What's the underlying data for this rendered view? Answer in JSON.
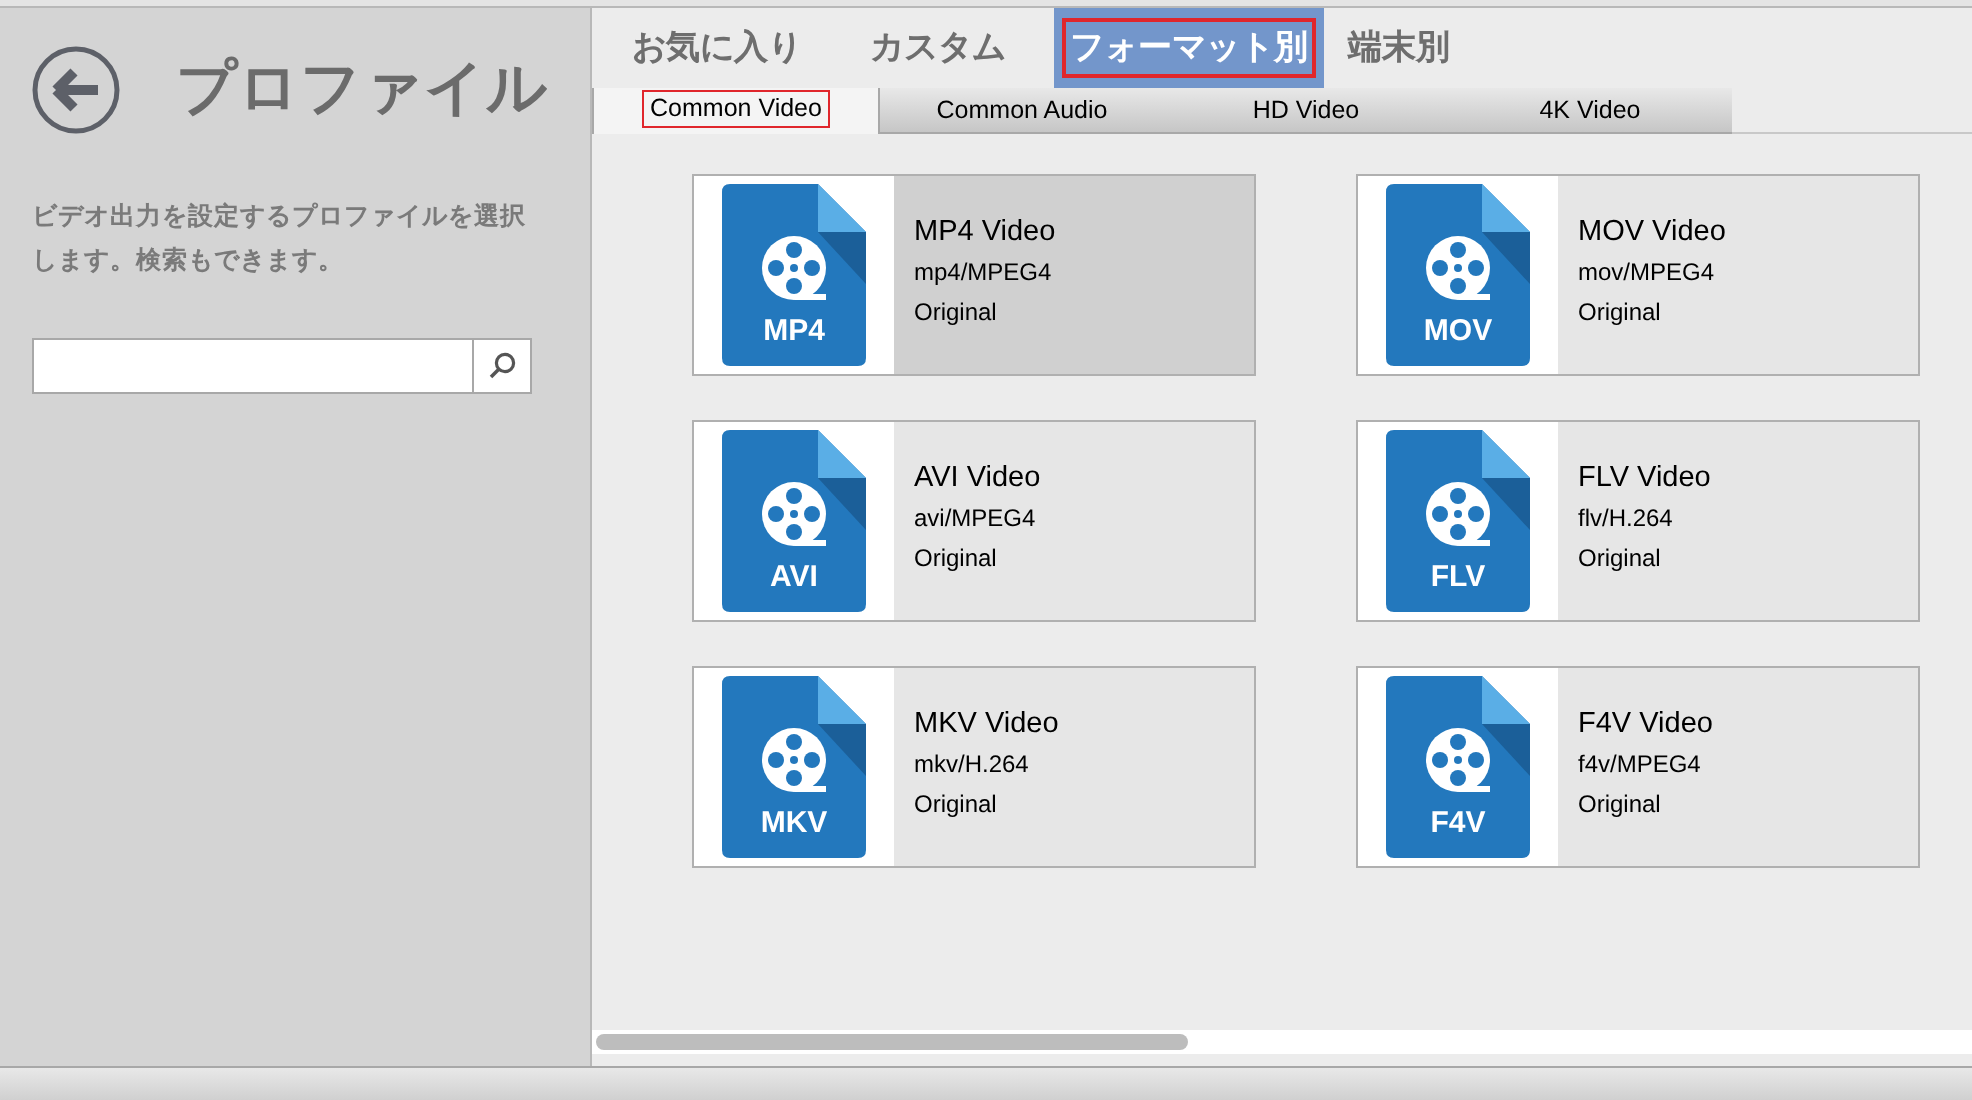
{
  "sidebar": {
    "title": "プロファイル",
    "description": "ビデオ出力を設定するプロファイルを選択します。検索もできます。"
  },
  "tabs": [
    {
      "label": "お気に入り",
      "selected": false
    },
    {
      "label": "カスタム",
      "selected": false
    },
    {
      "label": "フォーマット別",
      "selected": true
    },
    {
      "label": "端末別",
      "selected": false
    }
  ],
  "subtabs": [
    {
      "label": "Common Video",
      "selected": true
    },
    {
      "label": "Common Audio",
      "selected": false
    },
    {
      "label": "HD Video",
      "selected": false
    },
    {
      "label": "4K Video",
      "selected": false
    }
  ],
  "formats": [
    {
      "badge": "MP4",
      "name": "MP4 Video",
      "codec": "mp4/MPEG4",
      "quality": "Original",
      "selected": true
    },
    {
      "badge": "MOV",
      "name": "MOV Video",
      "codec": "mov/MPEG4",
      "quality": "Original",
      "selected": false
    },
    {
      "badge": "AVI",
      "name": "AVI Video",
      "codec": "avi/MPEG4",
      "quality": "Original",
      "selected": false
    },
    {
      "badge": "FLV",
      "name": "FLV Video",
      "codec": "flv/H.264",
      "quality": "Original",
      "selected": false
    },
    {
      "badge": "MKV",
      "name": "MKV Video",
      "codec": "mkv/H.264",
      "quality": "Original",
      "selected": false
    },
    {
      "badge": "F4V",
      "name": "F4V Video",
      "codec": "f4v/MPEG4",
      "quality": "Original",
      "selected": false
    }
  ]
}
